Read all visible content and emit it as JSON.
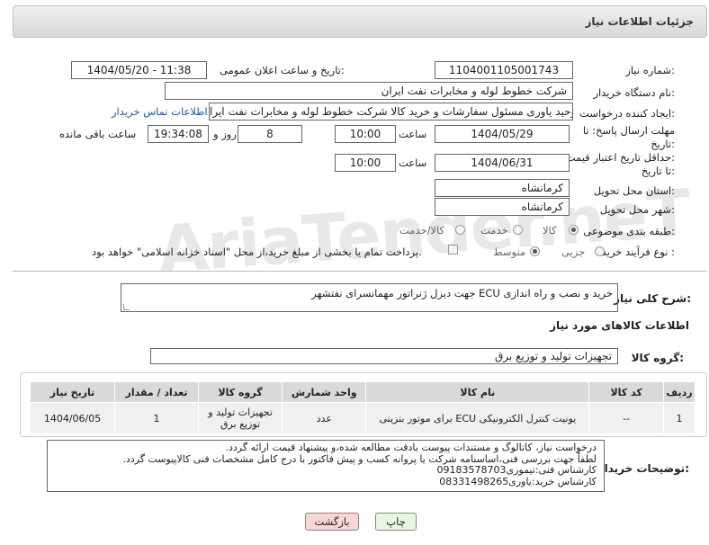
{
  "header": {
    "title": "جزئیات اطلاعات نیاز"
  },
  "fields": {
    "need_number_label": "شماره نیاز:",
    "need_number": "1104001105001743",
    "announce_label": "تاریخ و ساعت اعلان عمومی:",
    "announce_value": "1404/05/20 - 11:38",
    "buyer_org_label": "نام دستگاه خریدار:",
    "buyer_org": "شرکت خطوط لوله و مخابرات نفت ایران",
    "creator_label": "ایجاد کننده درخواست:",
    "creator": "وحید یاوری مسئول سفارشات و خرید کالا  شرکت خطوط لوله و مخابرات نفت ایرا",
    "contact_link": "اطلاعات تماس خریدار",
    "reply_deadline_label_1": "مهلت ارسال پاسخ: تا",
    "reply_deadline_label_2": "تاریخ:",
    "reply_date": "1404/05/29",
    "time_label": "ساعت",
    "reply_time": "10:00",
    "days": "8",
    "days_label": "روز و",
    "remaining_time": "19:34:08",
    "remaining_label": "ساعت باقی مانده",
    "price_deadline_label_1": "حداقل تاریخ اعتبار قیمت:",
    "price_deadline_label_2": "تا تاریخ:",
    "price_date": "1404/06/31",
    "price_time": "10:00",
    "province_label": "استان محل تحویل:",
    "province": "کرمانشاه",
    "city_label": "شهر محل تحویل:",
    "city": "کرمانشاه",
    "category_label": "طبقه بندی موضوعی:",
    "category_options": [
      "کالا",
      "خدمت",
      "کالا/خدمت"
    ],
    "process_label": "نوع فرآیند خرید :",
    "process_options": [
      "جزیی",
      "متوسط"
    ],
    "payment_note": "پرداخت تمام یا بخشی از مبلغ خرید،از محل \"اسناد خزانه اسلامی\" خواهد بود."
  },
  "description": {
    "label": "شرح کلی نیاز:",
    "value": "خرید و نصب و راه اندازی ECU جهت دیزل ژنراتور مهمانسرای نفتشهر"
  },
  "goods_section_title": "اطلاعات کالاهای مورد نیاز",
  "goods_group": {
    "label": "گروه کالا:",
    "value": "تجهیزات تولید و توزیع برق"
  },
  "table": {
    "headers": [
      "ردیف",
      "کد کالا",
      "نام کالا",
      "واحد شمارش",
      "گروه کالا",
      "تعداد / مقدار",
      "تاریخ نیاز"
    ],
    "rows": [
      [
        "1",
        "--",
        "یونیت کنترل الکترونیکی ECU برای موتور بنزینی",
        "عدد",
        "تجهیزات تولید و توزیع برق",
        "1",
        "1404/06/05"
      ]
    ]
  },
  "buyer_notes": {
    "label": "توضیحات خریدار:",
    "text": "درخواست نیاز، کاتالوگ و مستندات پیوست بادقت مطالعه شده،و پیشنهاد قیمت ارائه گردد.\nلطفاً جهت بررسی فنی،اساسنامه شرکت یا پروانه کسب و پیش فاکتور با درج کامل مشخصات فنی کالاپیوست گردد.\nکارشناس فنی:تیموری09183578703\nکارشناس خرید:یاوری08331498265"
  },
  "buttons": {
    "print": "چاپ",
    "back": "بازگشت"
  },
  "watermark": "AriaTender.neT",
  "colors": {
    "link": "#1a56b8",
    "back_button_bg": "#f9d6d6",
    "print_button_bg": "#e8f7e0"
  }
}
